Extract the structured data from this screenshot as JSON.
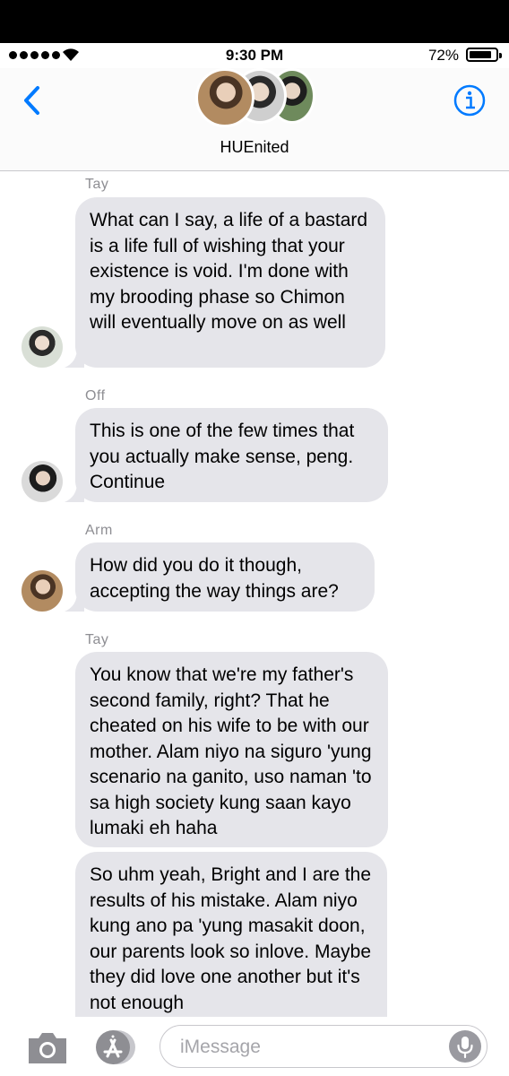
{
  "status_bar": {
    "time": "9:30 PM",
    "battery": "72%"
  },
  "header": {
    "group_name": "HUEnited"
  },
  "messages": [
    {
      "sender": "Tay",
      "text": "What can I say, a life of a bastard is a life full of wishing that your existence is void. I'm done with my brooding phase so Chimon will eventually move on as well"
    },
    {
      "sender": "Off",
      "text": "This is one of the few times that you actually make sense, peng. Continue"
    },
    {
      "sender": "Arm",
      "text": "How did you do it though, accepting the way things are?"
    },
    {
      "sender": "Tay",
      "text": "You know that we're my father's second family, right? That he cheated on his wife to be with our mother. Alam niyo na siguro 'yung scenario na ganito, uso naman 'to sa high society kung saan kayo lumaki eh haha"
    },
    {
      "sender": "",
      "text": "So uhm yeah, Bright and I are the results of his mistake. Alam niyo kung ano pa 'yung masakit doon, our parents look so inlove. Maybe they did love one another but it's not enough"
    }
  ],
  "composer": {
    "placeholder": "iMessage"
  },
  "icons": [
    "back-chevron-icon",
    "info-icon",
    "wifi-icon",
    "camera-icon",
    "app-store-icon",
    "microphone-icon"
  ],
  "colors": {
    "accent": "#007aff",
    "bubble": "#e5e5ea",
    "sender_label": "#8e8e93"
  }
}
